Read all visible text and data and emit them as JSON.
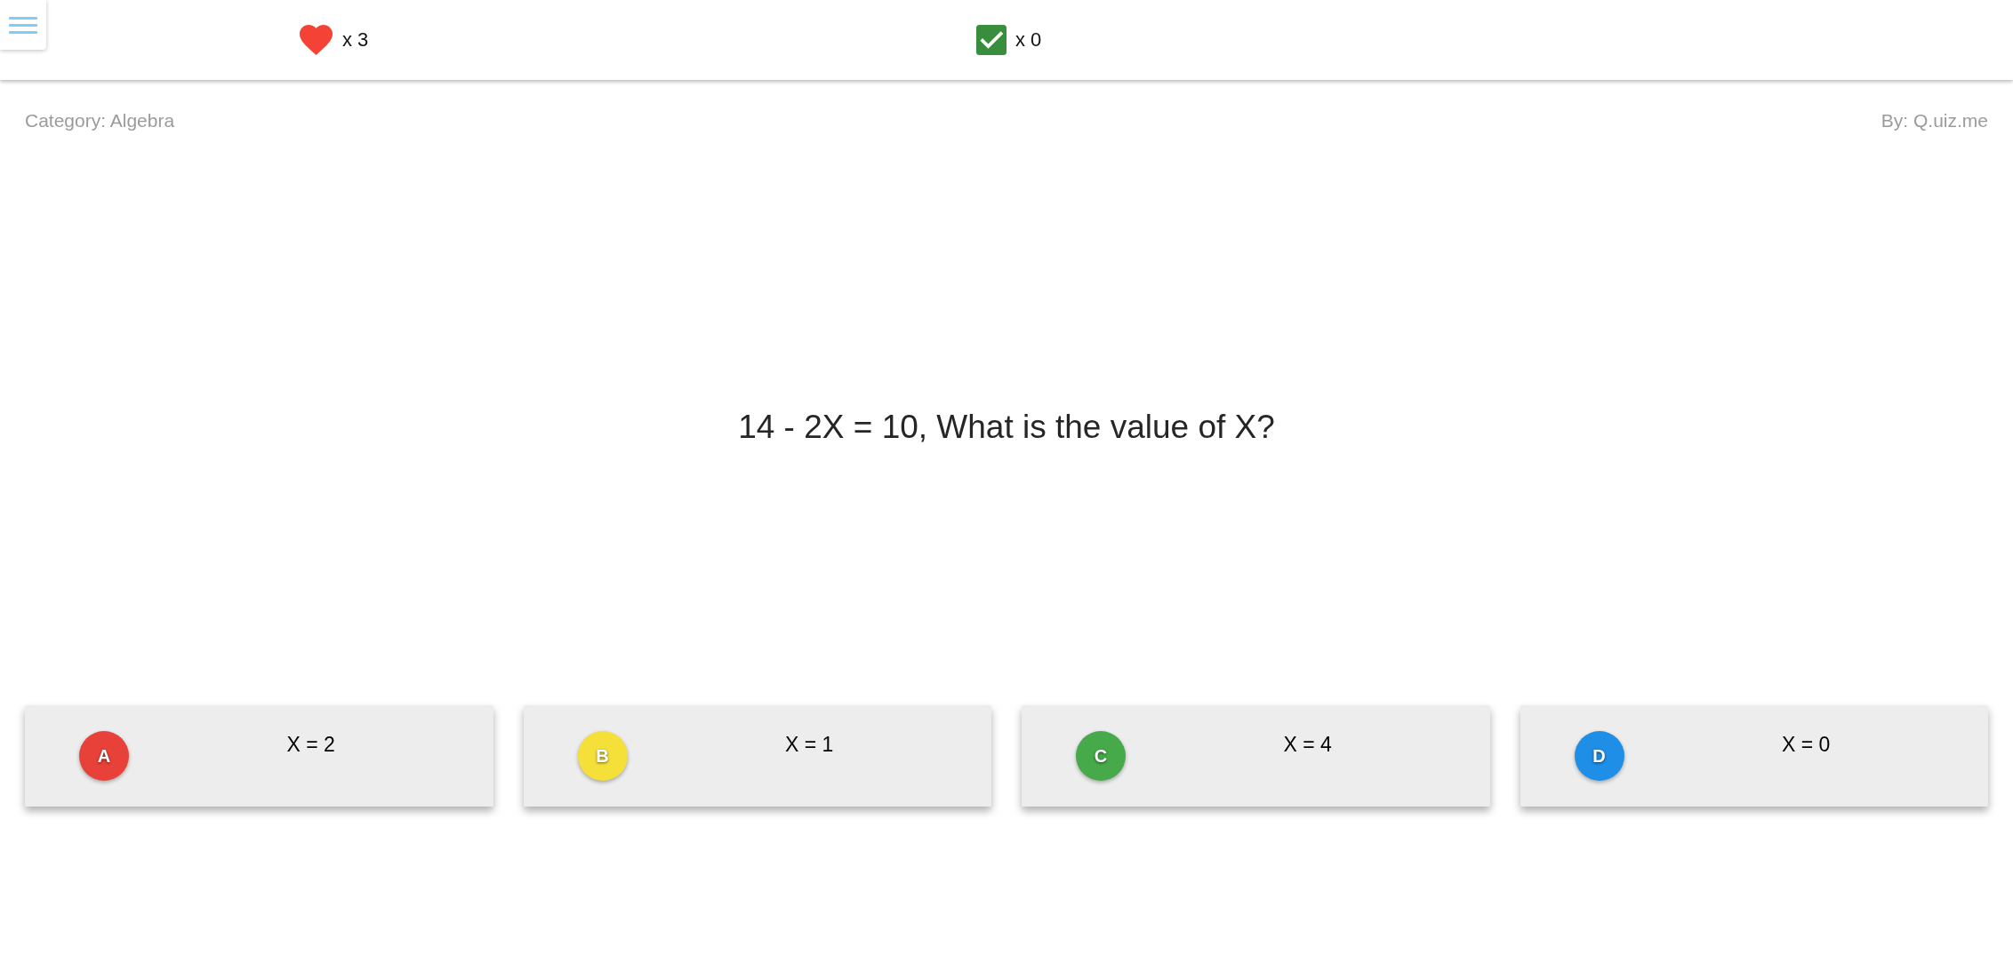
{
  "header": {
    "lives": "x 3",
    "correct": "x 0"
  },
  "quiz": {
    "category": "Category: Algebra",
    "author": "By: Q.uiz.me",
    "question": "14 - 2X = 10, What is the value of X?"
  },
  "answers": [
    {
      "letter": "A",
      "text": "X = 2",
      "color": "#e8413a",
      "selected": false
    },
    {
      "letter": "B",
      "text": "X = 1",
      "color": "#f5e03a",
      "selected": false
    },
    {
      "letter": "C",
      "text": "X = 4",
      "color": "#46a94a",
      "selected": false
    },
    {
      "letter": "D",
      "text": "X = 0",
      "color": "#1e8ee6",
      "selected": false
    }
  ]
}
